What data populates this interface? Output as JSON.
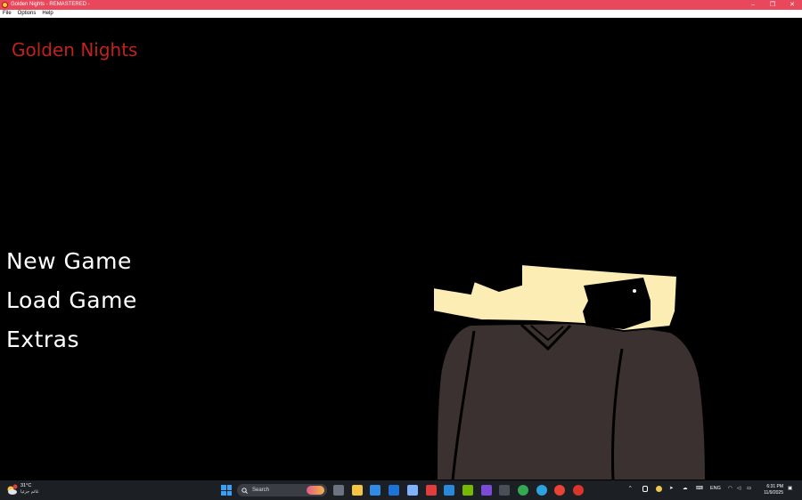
{
  "window": {
    "title": "Golden Nights - REMASTERED -",
    "minimize_glyph": "–",
    "maximize_glyph": "❐",
    "close_glyph": "✕"
  },
  "menubar": {
    "items": [
      "File",
      "Options",
      "Help"
    ]
  },
  "game": {
    "title": "Golden Nights",
    "title_color": "#c1221b",
    "options": [
      "New Game",
      "Load Game",
      "Extras"
    ],
    "character_colors": {
      "hair": "#fcedb4",
      "body": "#3b3130",
      "outline": "#000000"
    }
  },
  "taskbar": {
    "weather": {
      "temp": "31°C",
      "desc": "غائم جزئيا",
      "badge": "1"
    },
    "search_placeholder": "Search",
    "apps": [
      {
        "name": "task-view-icon",
        "color": "#6b7280"
      },
      {
        "name": "file-explorer-icon",
        "color": "#f4c542"
      },
      {
        "name": "store-icon",
        "color": "#2f8be6"
      },
      {
        "name": "outlook-icon",
        "color": "#1e74d6"
      },
      {
        "name": "copilot-icon",
        "color": "#7fb3ff"
      },
      {
        "name": "wps-icon",
        "color": "#e23d3d"
      },
      {
        "name": "vscode-icon",
        "color": "#2a88d8"
      },
      {
        "name": "nvidia-icon",
        "color": "#76b900"
      },
      {
        "name": "proton-vpn-icon",
        "color": "#7b4bd6"
      },
      {
        "name": "terminal-icon",
        "color": "#4a4f57"
      },
      {
        "name": "chrome-icon",
        "color": "#34a853"
      },
      {
        "name": "telegram-icon",
        "color": "#2aa3df"
      },
      {
        "name": "chrome-profile-icon",
        "color": "#e94335"
      },
      {
        "name": "golden-nights-app-icon",
        "color": "#d9352b"
      }
    ],
    "tray": {
      "language": "ENG",
      "time": "6:31 PM",
      "date": "11/9/2025"
    }
  }
}
